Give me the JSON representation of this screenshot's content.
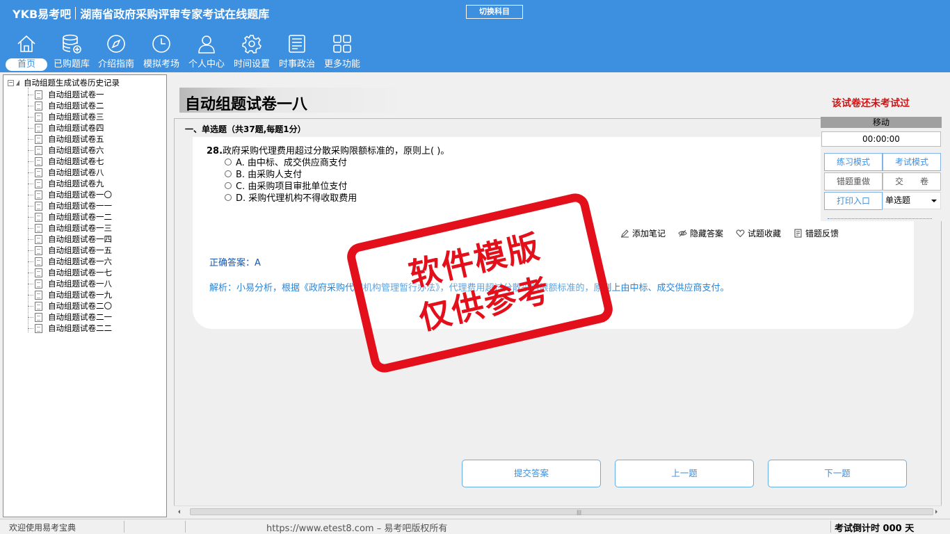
{
  "header": {
    "brand_logo": "YKB易考吧",
    "brand_title": "湖南省政府采购评审专家考试在线题库",
    "switch_subject": "切换科目"
  },
  "nav": [
    {
      "label": "首页",
      "icon": "home-icon",
      "active": true
    },
    {
      "label": "已购题库",
      "icon": "database-icon"
    },
    {
      "label": "介绍指南",
      "icon": "compass-icon"
    },
    {
      "label": "模拟考场",
      "icon": "clock-icon"
    },
    {
      "label": "个人中心",
      "icon": "user-icon"
    },
    {
      "label": "时间设置",
      "icon": "gear-icon"
    },
    {
      "label": "时事政治",
      "icon": "newspaper-icon"
    },
    {
      "label": "更多功能",
      "icon": "grid-icon"
    }
  ],
  "tree": {
    "root": "自动组题生成试卷历史记录",
    "items": [
      "自动组题试卷一",
      "自动组题试卷二",
      "自动组题试卷三",
      "自动组题试卷四",
      "自动组题试卷五",
      "自动组题试卷六",
      "自动组题试卷七",
      "自动组题试卷八",
      "自动组题试卷九",
      "自动组题试卷一〇",
      "自动组题试卷一一",
      "自动组题试卷一二",
      "自动组题试卷一三",
      "自动组题试卷一四",
      "自动组题试卷一五",
      "自动组题试卷一六",
      "自动组题试卷一七",
      "自动组题试卷一八",
      "自动组题试卷一九",
      "自动组题试卷二〇",
      "自动组题试卷二一",
      "自动组题试卷二二"
    ]
  },
  "paper": {
    "title": "自动组题试卷一八",
    "status": "该试卷还未考试过",
    "section": "一、单选题（共37题,每题1分）"
  },
  "question": {
    "number": "28.",
    "text": "政府采购代理费用超过分散采购限额标准的，原则上(  )。",
    "options": [
      "A. 由中标、成交供应商支付",
      "B. 由采购人支付",
      "C. 由采购项目审批单位支付",
      "D. 采购代理机构不得收取费用"
    ],
    "answer": "正确答案：A",
    "analysis": "解析：小易分析，根据《政府采购代理机构管理暂行办法》，代理费用超过分散采购限额标准的，原则上由中标、成交供应商支付。"
  },
  "tools": [
    {
      "label": "添加笔记",
      "icon": "pencil-icon"
    },
    {
      "label": "隐藏答案",
      "icon": "eye-hide-icon"
    },
    {
      "label": "试题收藏",
      "icon": "heart-icon"
    },
    {
      "label": "错题反馈",
      "icon": "feedback-icon"
    }
  ],
  "side": {
    "move": "移动",
    "timer": "00:00:00",
    "practice": "练习模式",
    "exam": "考试模式",
    "redo": "错题重做",
    "submit_paper": "交　　卷",
    "print": "打印入口",
    "type_select": "单选题"
  },
  "buttons": {
    "submit": "提交答案",
    "prev": "上一题",
    "next": "下一题"
  },
  "stamp": {
    "line1": "软件模版",
    "line2": "仅供参考"
  },
  "status": {
    "welcome": "欢迎使用易考宝典",
    "copyright": "https://www.etest8.com – 易考吧版权所有",
    "countdown": "考试倒计时 000 天"
  },
  "colors": {
    "header_bg": "#3d8fe0",
    "stamp_red": "#e3101c",
    "status_red": "#d01414"
  }
}
